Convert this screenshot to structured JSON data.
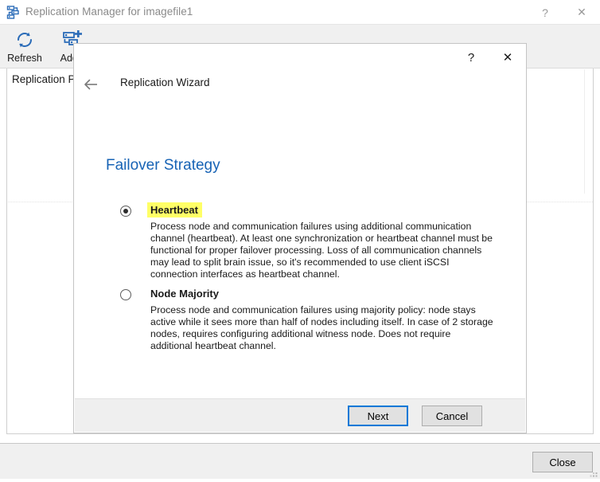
{
  "app": {
    "title": "Replication Manager for imagefile1",
    "title_icon": "replication-server-icon",
    "help_label": "?",
    "close_label": "✕",
    "toolbar": {
      "refresh_label": "Refresh",
      "refresh_icon": "refresh-circular-arrows-icon",
      "add_replica_label": "Add R",
      "add_replica_icon": "add-replica-icon",
      "close_tab_label": "✖"
    },
    "panel": {
      "tab_label": "Replication Partr"
    },
    "bottom": {
      "close_label": "Close",
      "resize_grip_icon": "resize-grip-icon"
    }
  },
  "dialog": {
    "help_label": "?",
    "close_label": "✕",
    "back_label": "←",
    "wizard_title": "Replication Wizard",
    "page_heading": "Failover Strategy",
    "options": [
      {
        "id": "heartbeat",
        "title": "Heartbeat",
        "selected": true,
        "highlighted": true,
        "description": "Process node and communication failures using additional communication channel (heartbeat). At least one synchronization or heartbeat channel must be functional for proper failover processing. Loss of all communication channels may lead to split brain issue, so it's recommended to use client iSCSI connection interfaces as heartbeat channel."
      },
      {
        "id": "node-majority",
        "title": "Node Majority",
        "selected": false,
        "highlighted": false,
        "description": "Process node and communication failures using majority policy: node stays active while it sees more than half of nodes including itself. In case of 2 storage nodes, requires configuring additional witness node. Does not require additional heartbeat channel."
      }
    ],
    "footer": {
      "next_label": "Next",
      "cancel_label": "Cancel"
    }
  },
  "colors": {
    "heading_blue": "#1763b5",
    "highlight_yellow": "#ffff66",
    "focus_blue": "#0078d7",
    "icon_blue": "#2b6cb8",
    "toolbar_bg": "#f0f0f0"
  }
}
